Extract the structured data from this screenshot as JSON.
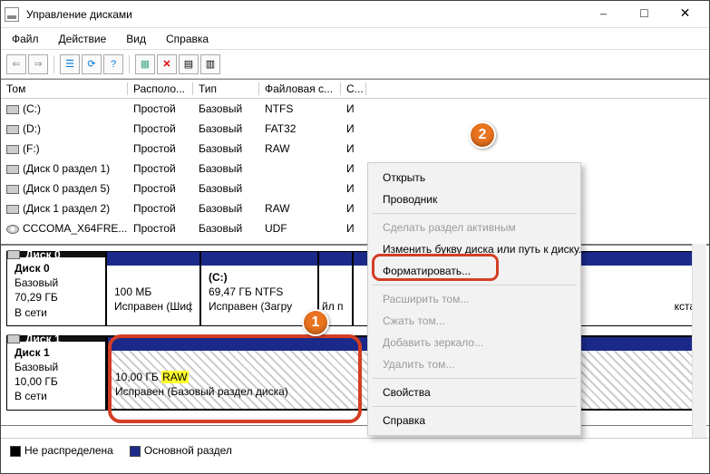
{
  "window": {
    "title": "Управление дисками"
  },
  "menu": {
    "file": "Файл",
    "action": "Действие",
    "view": "Вид",
    "help": "Справка"
  },
  "columns": {
    "vol": "Том",
    "layout": "Располо...",
    "type": "Тип",
    "fs": "Файловая с...",
    "status": "С..."
  },
  "volumes": [
    {
      "name": "(C:)",
      "layout": "Простой",
      "type": "Базовый",
      "fs": "NTFS",
      "status": "И",
      "icon": "drive"
    },
    {
      "name": "(D:)",
      "layout": "Простой",
      "type": "Базовый",
      "fs": "FAT32",
      "status": "И",
      "icon": "drive"
    },
    {
      "name": "(F:)",
      "layout": "Простой",
      "type": "Базовый",
      "fs": "RAW",
      "status": "И",
      "icon": "drive"
    },
    {
      "name": "(Диск 0 раздел 1)",
      "layout": "Простой",
      "type": "Базовый",
      "fs": "",
      "status": "И",
      "icon": "drive"
    },
    {
      "name": "(Диск 0 раздел 5)",
      "layout": "Простой",
      "type": "Базовый",
      "fs": "",
      "status": "И",
      "icon": "drive"
    },
    {
      "name": "(Диск 1 раздел 2)",
      "layout": "Простой",
      "type": "Базовый",
      "fs": "RAW",
      "status": "И",
      "icon": "drive"
    },
    {
      "name": "CCCOMA_X64FRE...",
      "layout": "Простой",
      "type": "Базовый",
      "fs": "UDF",
      "status": "И",
      "icon": "disc"
    }
  ],
  "ctx": {
    "open": "Открыть",
    "explorer": "Проводник",
    "active": "Сделать раздел активным",
    "change_letter": "Изменить букву диска или путь к диску...",
    "format": "Форматировать...",
    "extend": "Расширить том...",
    "shrink": "Сжать том...",
    "mirror": "Добавить зеркало...",
    "delete": "Удалить том...",
    "props": "Свойства",
    "help": "Справка"
  },
  "disks": {
    "d0": {
      "name": "Диск 0",
      "type": "Базовый",
      "size": "70,29 ГБ",
      "status": "В сети"
    },
    "d0p1": {
      "size": "100 МБ",
      "health": "Исправен (Шифр"
    },
    "d0p2": {
      "label": "(C:)",
      "size": "69,47 ГБ NTFS",
      "health": "Исправен (Загру"
    },
    "d0p3": {
      "health": "кста"
    },
    "d1": {
      "name": "Диск 1",
      "type": "Базовый",
      "size": "10,00 ГБ",
      "status": "В сети"
    },
    "d1p": {
      "size_pre": "10,00 ГБ ",
      "size_raw": "RAW",
      "health": "Исправен (Базовый раздел диска)"
    }
  },
  "legend": {
    "unalloc": "Не распределена",
    "primary": "Основной раздел"
  },
  "markers": {
    "one": "1",
    "two": "2"
  },
  "hidden": {
    "p1": "йл п"
  }
}
